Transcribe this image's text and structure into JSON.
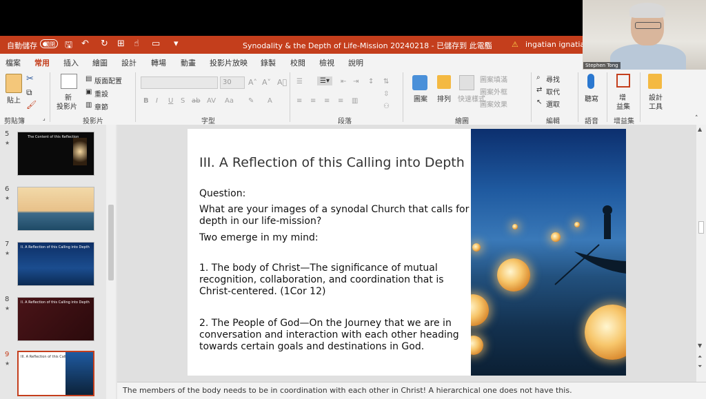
{
  "titlebar": {
    "autosave_label": "自動儲存",
    "autosave_state": "關閉",
    "document_title": "Synodality & the Depth of Life-Mission 20240218 - 已儲存到 此電腦",
    "user_name": "ingatian ignatian"
  },
  "video": {
    "participant_name": "Stephen Tong"
  },
  "tabs": [
    "檔案",
    "常用",
    "插入",
    "繪圖",
    "設計",
    "轉場",
    "動畫",
    "投影片放映",
    "錄製",
    "校閱",
    "檢視",
    "說明"
  ],
  "active_tab": "常用",
  "ribbon": {
    "groups": {
      "clipboard": "剪貼簿",
      "slides": "投影片",
      "font": "字型",
      "paragraph": "段落",
      "drawing": "繪圖",
      "editing": "編輯",
      "voice": "語音",
      "addins": "增益集"
    },
    "paste": "貼上",
    "new_slide": "新\n投影片",
    "new_slide_line1": "新",
    "new_slide_line2": "投影片",
    "layout": "版面配置",
    "reset": "重設",
    "section": "章節",
    "font_size": "30",
    "shape": "圖案",
    "arrange": "排列",
    "quick_styles": "快速樣式",
    "shape_fill": "圖案填滿",
    "shape_outline": "圖案外框",
    "shape_effects": "圖案效果",
    "find": "尋找",
    "replace": "取代",
    "select": "選取",
    "dictate": "聽寫",
    "addins_btn": "增益集",
    "designer": "設計工具",
    "addins_line1": "增",
    "addins_line2": "益集",
    "designer_line1": "設計",
    "designer_line2": "工具"
  },
  "thumbnails": [
    {
      "number": "5",
      "title": "The Content of this Reflection"
    },
    {
      "number": "6",
      "title": ""
    },
    {
      "number": "7",
      "title": "II. A Reflection of this Calling into Depth"
    },
    {
      "number": "8",
      "title": "II. A Reflection of this Calling into Depth"
    },
    {
      "number": "9",
      "title": "III. A Reflection of this Calling into Depth"
    }
  ],
  "slide": {
    "title": "III. A Reflection of this Calling into Depth",
    "question_label": "Question:",
    "question": "What are your images of a synodal Church that calls for depth in our life-mission?",
    "two_emerge": "Two emerge in my mind:",
    "point1": "1. The body of Christ—The significance of mutual recognition, collaboration, and coordination that is Christ-centered. (1Cor 12)",
    "point2": "2. The People of God—On the Journey that we are in conversation and interaction with each other heading towards certain goals and destinations in God."
  },
  "notes": "The members of the body needs to be in coordination with each other in Christ! A hierarchical one does not have this.",
  "colors": {
    "accent": "#c43e1c",
    "ribbon_bg": "#f3f3f3"
  }
}
